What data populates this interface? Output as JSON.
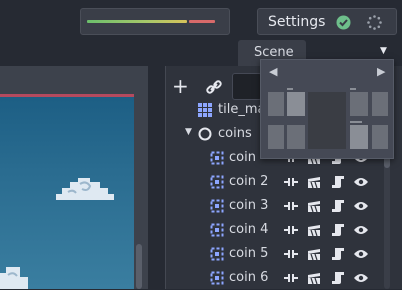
{
  "top_bar": {
    "settings_label": "Settings",
    "meter_colors": {
      "green": "#6cbf6c",
      "yellow": "#d7c35a",
      "red": "#d86a6a"
    }
  },
  "dock": {
    "scene_tab_label": "Scene"
  },
  "scene_tree": {
    "items": [
      {
        "name": "tile_ma",
        "type": "tilemap",
        "depth": 1,
        "visible_toggle": false
      },
      {
        "name": "coins",
        "type": "node2d",
        "depth": 1,
        "expanded": true,
        "visible_toggle": false
      },
      {
        "name": "coin",
        "type": "area2d",
        "depth": 2,
        "visible_toggle": true
      },
      {
        "name": "coin 2",
        "type": "area2d",
        "depth": 2,
        "visible_toggle": true
      },
      {
        "name": "coin 3",
        "type": "area2d",
        "depth": 2,
        "visible_toggle": true
      },
      {
        "name": "coin 4",
        "type": "area2d",
        "depth": 2,
        "visible_toggle": true
      },
      {
        "name": "coin 5",
        "type": "area2d",
        "depth": 2,
        "visible_toggle": true
      },
      {
        "name": "coin 6",
        "type": "area2d",
        "depth": 2,
        "visible_toggle": true
      }
    ]
  },
  "colors": {
    "accent": "#8da6ff",
    "checked_green": "#6ebf8b",
    "viewport_sky": "#2a6c90",
    "viewport_border": "#b54a5e"
  }
}
